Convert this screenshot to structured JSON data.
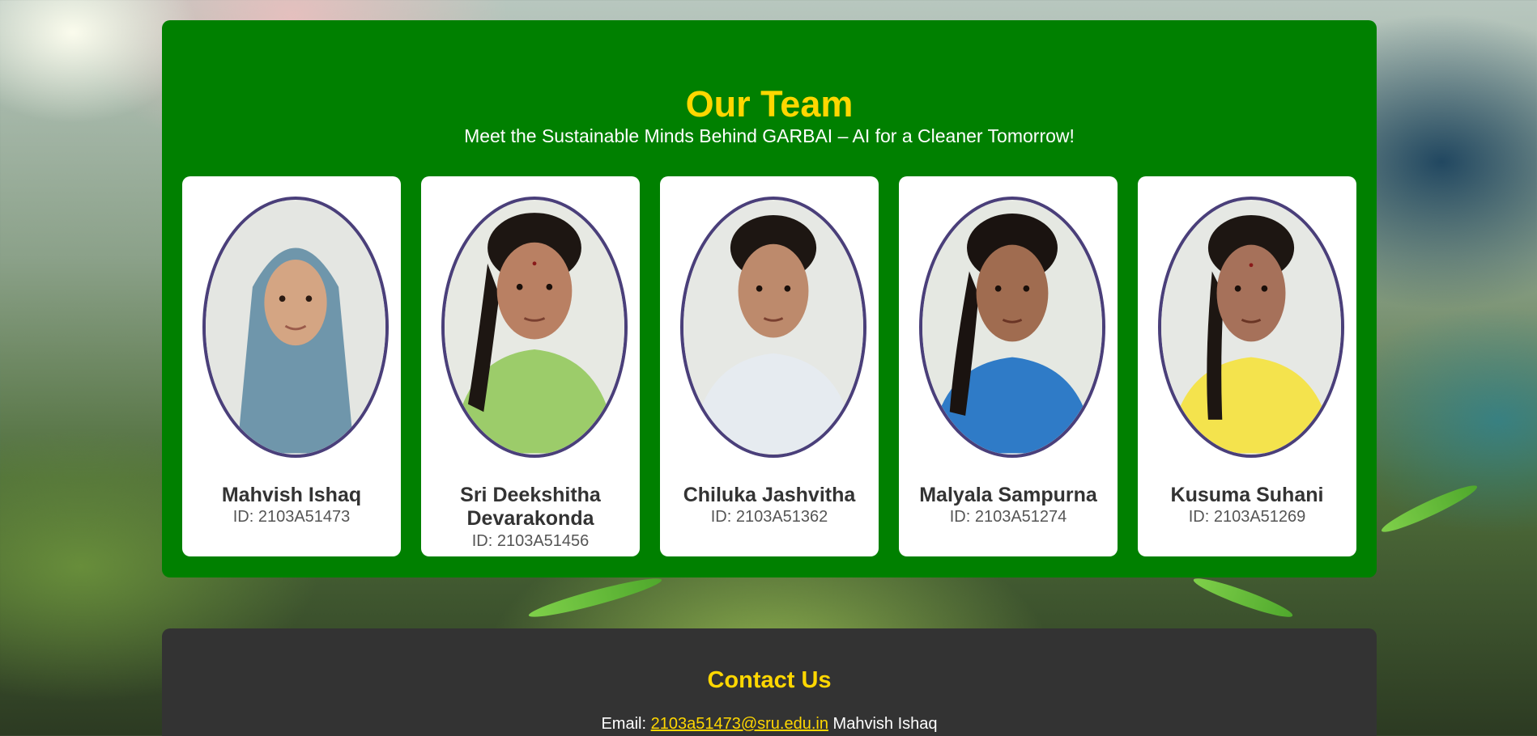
{
  "team": {
    "title": "Our Team",
    "subtitle": "Meet the Sustainable Minds Behind GARBAI – AI for a Cleaner Tomorrow!",
    "members": [
      {
        "name": "Mahvish Ishaq",
        "id": "ID: 2103A51473",
        "outfit": "#6f96ab"
      },
      {
        "name": "Sri Deekshitha Devarakonda",
        "id": "ID: 2103A51456",
        "outfit": "#9ccc6a"
      },
      {
        "name": "Chiluka Jashvitha",
        "id": "ID: 2103A51362",
        "outfit": "#e6ebf0"
      },
      {
        "name": "Malyala Sampurna",
        "id": "ID: 2103A51274",
        "outfit": "#2f7bc7"
      },
      {
        "name": "Kusuma Suhani",
        "id": "ID: 2103A51269",
        "outfit": "#f4e34d"
      }
    ]
  },
  "contact": {
    "title": "Contact Us",
    "email_label": "Email:",
    "email": "2103a51473@sru.edu.in",
    "email_name": "Mahvish Ishaq"
  },
  "colors": {
    "team_bg": "#008000",
    "accent": "#ffd700",
    "contact_bg": "#333333",
    "photo_border": "#4a3f7a"
  }
}
